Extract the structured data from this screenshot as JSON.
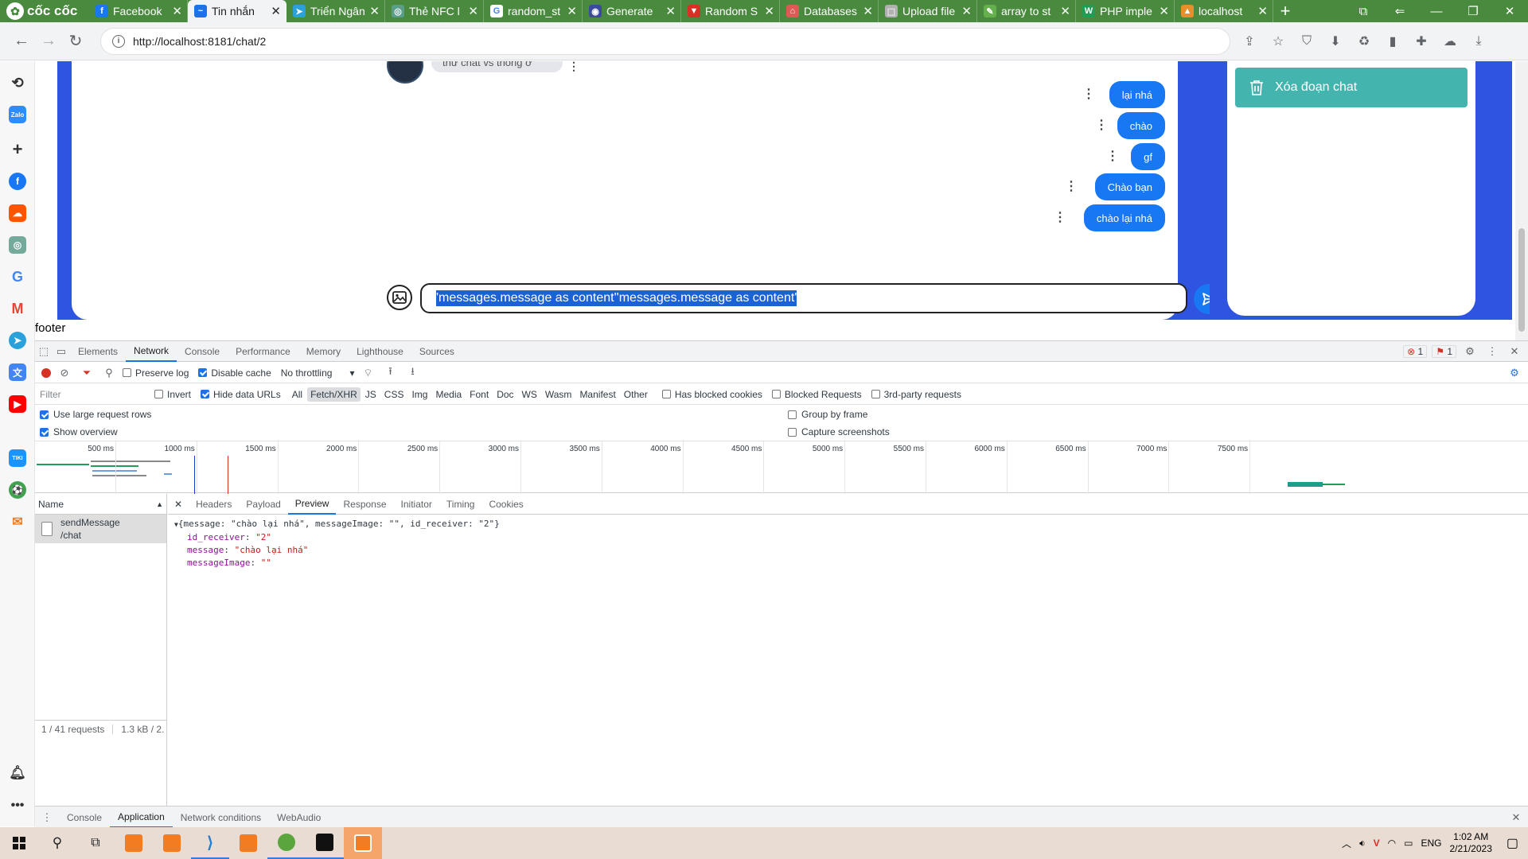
{
  "browser": {
    "brand": "cốc cốc",
    "tabs": [
      {
        "label": "Facebook",
        "icon": "facebook-icon",
        "color": "#1877f2",
        "glyph": "f"
      },
      {
        "label": "Tin nhắn",
        "icon": "chat-icon",
        "color": "#1a73e8",
        "glyph": "~",
        "active": true
      },
      {
        "label": "Triển Ngân",
        "icon": "telegram-icon",
        "color": "#2aa1da",
        "glyph": "➤"
      },
      {
        "label": "Thẻ NFC l",
        "icon": "chatgpt-icon",
        "color": "#5a9e8a",
        "glyph": "◎"
      },
      {
        "label": "random_st",
        "icon": "google-icon",
        "color": "#ffffff",
        "glyph": "G"
      },
      {
        "label": "Generate",
        "icon": "generate-icon",
        "color": "#3c4a9e",
        "glyph": "◉"
      },
      {
        "label": "Random S",
        "icon": "random-icon",
        "color": "#d93025",
        "glyph": "▼"
      },
      {
        "label": "Databases",
        "icon": "database-icon",
        "color": "#e05a55",
        "glyph": "⌂"
      },
      {
        "label": "Upload file",
        "icon": "upload-icon",
        "color": "#b0b0b0",
        "glyph": "⬚"
      },
      {
        "label": "array to st",
        "icon": "array-icon",
        "color": "#64b04c",
        "glyph": "✎"
      },
      {
        "label": "PHP imple",
        "icon": "php-icon",
        "color": "#1f9d55",
        "glyph": "W"
      },
      {
        "label": "localhost",
        "icon": "localhost-icon",
        "color": "#e88f2a",
        "glyph": "▲"
      }
    ],
    "url": "http://localhost:8181/chat/2"
  },
  "chat": {
    "first_message": "thử chat vs thông ơ",
    "messages": [
      "lại nhá",
      "chào",
      "gf",
      "Chào bạn",
      "chào lại nhá"
    ],
    "input_value": "'messages.message as content''messages.message as content'",
    "delete_label": "Xóa đoạn chat",
    "footer": "footer"
  },
  "devtools": {
    "tabs": [
      "Elements",
      "Network",
      "Console",
      "Performance",
      "Memory",
      "Lighthouse",
      "Sources"
    ],
    "active_tab": "Network",
    "errors": "1",
    "issues": "1",
    "toolbar": {
      "preserve_log": "Preserve log",
      "disable_cache": "Disable cache",
      "throttling": "No throttling"
    },
    "filter": {
      "placeholder": "Filter",
      "invert": "Invert",
      "hide_data_urls": "Hide data URLs",
      "types": [
        "All",
        "Fetch/XHR",
        "JS",
        "CSS",
        "Img",
        "Media",
        "Font",
        "Doc",
        "WS",
        "Wasm",
        "Manifest",
        "Other"
      ],
      "selected_type": "Fetch/XHR",
      "has_blocked_cookies": "Has blocked cookies",
      "blocked_requests": "Blocked Requests",
      "third_party": "3rd-party requests"
    },
    "options": {
      "large_rows": "Use large request rows",
      "show_overview": "Show overview",
      "group_by_frame": "Group by frame",
      "capture_screenshots": "Capture screenshots"
    },
    "timeline_ticks": [
      "500 ms",
      "1000 ms",
      "1500 ms",
      "2000 ms",
      "2500 ms",
      "3000 ms",
      "3500 ms",
      "4000 ms",
      "4500 ms",
      "5000 ms",
      "5500 ms",
      "6000 ms",
      "6500 ms",
      "7000 ms",
      "7500 ms"
    ],
    "name_header": "Name",
    "request": {
      "name": "sendMessage",
      "path": "/chat"
    },
    "status": {
      "requests": "1 / 41 requests",
      "size": "1.3 kB / 2."
    },
    "detail_tabs": [
      "Headers",
      "Payload",
      "Preview",
      "Response",
      "Initiator",
      "Timing",
      "Cookies"
    ],
    "active_detail_tab": "Preview",
    "preview": {
      "summary": "{message: \"chào lại nhá\", messageImage: \"\", id_receiver: \"2\"}",
      "fields": [
        {
          "key": "id_receiver",
          "value": "\"2\""
        },
        {
          "key": "message",
          "value": "\"chào lại nhá\""
        },
        {
          "key": "messageImage",
          "value": "\"\""
        }
      ]
    },
    "drawer_tabs": [
      "Console",
      "Application",
      "Network conditions",
      "WebAudio"
    ],
    "active_drawer_tab": "Application"
  },
  "taskbar": {
    "language": "ENG",
    "time": "1:02 AM",
    "date": "2/21/2023"
  },
  "colors": {
    "chat_blue": "#1877f2",
    "panel_blue": "#2f55e0",
    "delete_teal": "#44b5ae",
    "browser_green": "#4a8a3e"
  }
}
